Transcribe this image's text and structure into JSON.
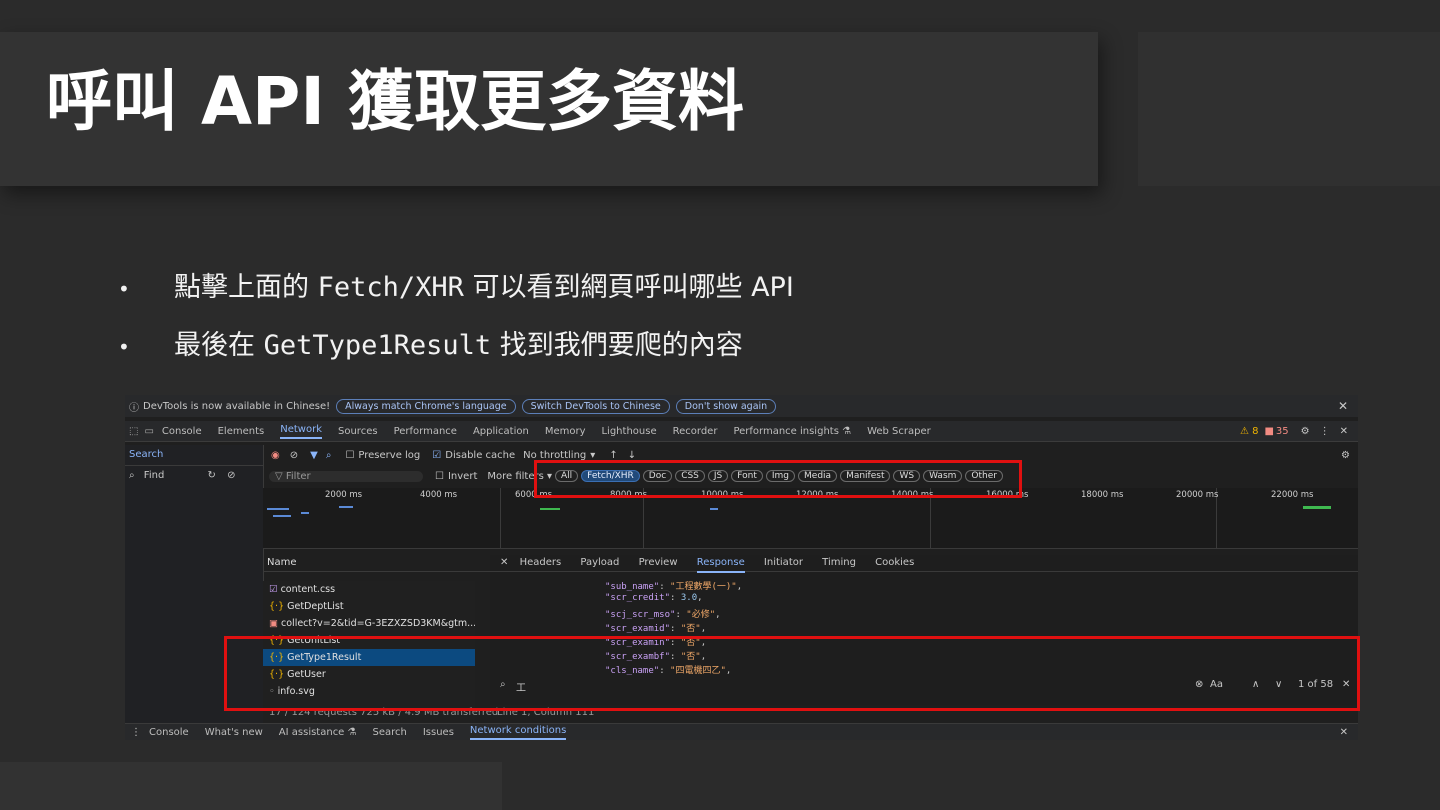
{
  "slide": {
    "title": "呼叫 API 獲取更多資料",
    "bullets": [
      {
        "prefix": "點擊上面的 ",
        "code": "Fetch/XHR",
        "suffix": " 可以看到網頁呼叫哪些 API"
      },
      {
        "prefix": "最後在 ",
        "code": "GetType1Result",
        "suffix": " 找到我們要爬的內容"
      }
    ],
    "bullet_glyph": "•"
  },
  "devtools": {
    "infobar": {
      "message": "DevTools is now available in Chinese!",
      "buttons": [
        "Always match Chrome's language",
        "Switch DevTools to Chinese",
        "Don't show again"
      ],
      "close": "✕"
    },
    "tabs": [
      "Console",
      "Elements",
      "Network",
      "Sources",
      "Performance",
      "Application",
      "Memory",
      "Lighthouse",
      "Recorder",
      "Performance insights ⚗",
      "Web Scraper"
    ],
    "active_tab": "Network",
    "warnings": "⚠ 8",
    "errors": "35",
    "search_label": "Search",
    "find_label": "Find",
    "preserve_log": "Preserve log",
    "disable_cache": "Disable cache",
    "throttling": "No throttling",
    "filter_placeholder": "Filter",
    "invert": "Invert",
    "more_filters": "More filters ▾",
    "filter_chips": [
      "All",
      "Fetch/XHR",
      "Doc",
      "CSS",
      "JS",
      "Font",
      "Img",
      "Media",
      "Manifest",
      "WS",
      "Wasm",
      "Other"
    ],
    "active_chip": "Fetch/XHR",
    "timeline_ticks": [
      "2000 ms",
      "4000 ms",
      "6000 ms",
      "8000 ms",
      "10000 ms",
      "12000 ms",
      "14000 ms",
      "16000 ms",
      "18000 ms",
      "20000 ms",
      "22000 ms"
    ],
    "name_header": "Name",
    "requests": [
      "content.css",
      "GetDeptList",
      "collect?v=2&tid=G-3EZXZSD3KM&gtm...",
      "GetUnitList",
      "GetType1Result",
      "GetUser",
      "info.svg"
    ],
    "selected_request": "GetType1Result",
    "status_line": "17 / 124 requests   725 kB / 4.9 MB transferred",
    "detail_tabs": [
      "Headers",
      "Payload",
      "Preview",
      "Response",
      "Initiator",
      "Timing",
      "Cookies"
    ],
    "active_detail_tab": "Response",
    "response_lines": [
      {
        "key": "\"sub_name\"",
        "value": "\"工程數學(一)\""
      },
      {
        "key": "\"scr_credit\"",
        "value": "3.0"
      },
      {
        "key": "\"scj_scr_mso\"",
        "value": "\"必修\""
      },
      {
        "key": "\"scr_examid\"",
        "value": "\"否\""
      },
      {
        "key": "\"scr_examin\"",
        "value": "\"否\""
      },
      {
        "key": "\"scr_exambf\"",
        "value": "\"否\""
      },
      {
        "key": "\"cls_name\"",
        "value": "\"四電機四乙\""
      }
    ],
    "find_query": "工",
    "find_count": "1 of 58",
    "cursor_pos": "Line 1, Column 111",
    "bottom_tabs": [
      "Console",
      "What's new",
      "AI assistance ⚗",
      "Search",
      "Issues",
      "Network conditions"
    ],
    "active_bottom_tab": "Network conditions"
  },
  "colors": {
    "highlight_box": "#e01010",
    "accent": "#8ab4f8",
    "background": "#2b2b2b"
  }
}
